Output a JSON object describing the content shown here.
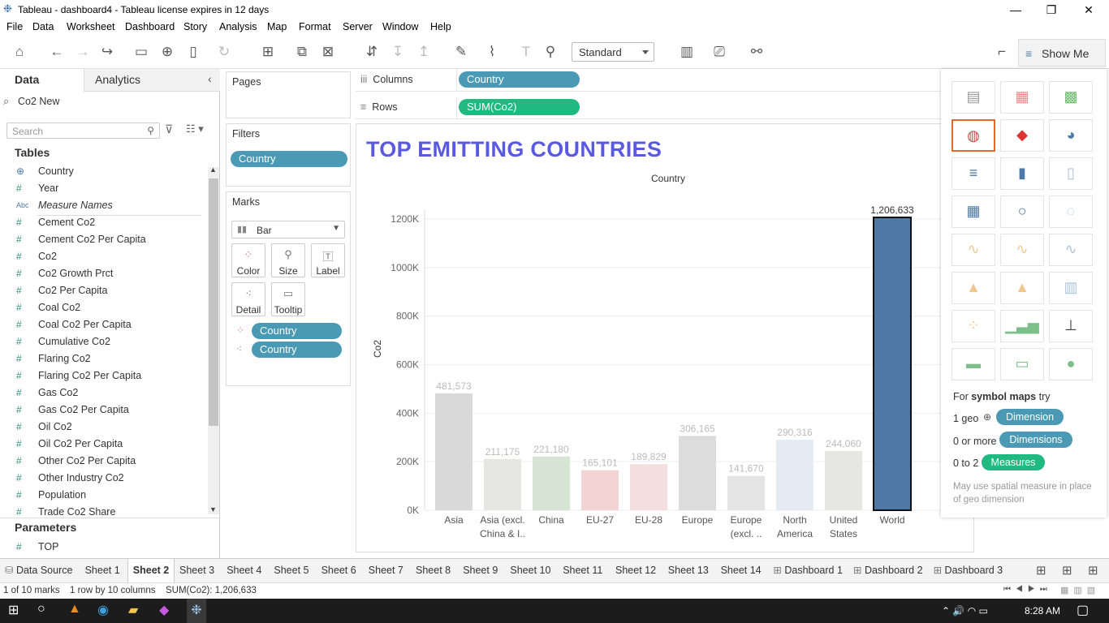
{
  "window": {
    "title": "Tableau - dashboard4 - Tableau license expires in 12 days"
  },
  "menu": [
    "File",
    "Data",
    "Worksheet",
    "Dashboard",
    "Story",
    "Analysis",
    "Map",
    "Format",
    "Server",
    "Window",
    "Help"
  ],
  "toolbar": {
    "fit_select": "Standard",
    "show_me_label": "Show Me"
  },
  "left_panel": {
    "tabs": {
      "data": "Data",
      "analytics": "Analytics"
    },
    "datasource": "Co2 New",
    "search_placeholder": "Search",
    "tables_title": "Tables",
    "fields": [
      {
        "icon": "globe",
        "type": "geo",
        "name": "Country"
      },
      {
        "icon": "#",
        "type": "num",
        "name": "Year"
      },
      {
        "icon": "Abc",
        "type": "text",
        "name": "Measure Names"
      },
      {
        "icon": "#",
        "type": "num",
        "name": "Cement Co2"
      },
      {
        "icon": "#",
        "type": "num",
        "name": "Cement Co2 Per Capita"
      },
      {
        "icon": "#",
        "type": "num",
        "name": "Co2"
      },
      {
        "icon": "#",
        "type": "num",
        "name": "Co2 Growth Prct"
      },
      {
        "icon": "#",
        "type": "num",
        "name": "Co2 Per Capita"
      },
      {
        "icon": "#",
        "type": "num",
        "name": "Coal Co2"
      },
      {
        "icon": "#",
        "type": "num",
        "name": "Coal Co2 Per Capita"
      },
      {
        "icon": "#",
        "type": "num",
        "name": "Cumulative Co2"
      },
      {
        "icon": "#",
        "type": "num",
        "name": "Flaring Co2"
      },
      {
        "icon": "#",
        "type": "num",
        "name": "Flaring Co2 Per Capita"
      },
      {
        "icon": "#",
        "type": "num",
        "name": "Gas Co2"
      },
      {
        "icon": "#",
        "type": "num",
        "name": "Gas Co2 Per Capita"
      },
      {
        "icon": "#",
        "type": "num",
        "name": "Oil Co2"
      },
      {
        "icon": "#",
        "type": "num",
        "name": "Oil Co2 Per Capita"
      },
      {
        "icon": "#",
        "type": "num",
        "name": "Other Co2 Per Capita"
      },
      {
        "icon": "#",
        "type": "num",
        "name": "Other Industry Co2"
      },
      {
        "icon": "#",
        "type": "num",
        "name": "Population"
      },
      {
        "icon": "#",
        "type": "num",
        "name": "Trade Co2 Share"
      }
    ],
    "parameters_title": "Parameters",
    "parameters": [
      "TOP"
    ]
  },
  "shelves": {
    "pages": "Pages",
    "filters": "Filters",
    "filter_pills": [
      "Country"
    ],
    "marks": "Marks",
    "mark_type": "Bar",
    "mark_buttons": [
      "Color",
      "Size",
      "Label",
      "Detail",
      "Tooltip"
    ],
    "mark_pills": [
      "Country",
      "Country"
    ],
    "columns_label": "Columns",
    "columns_pill": "Country",
    "rows_label": "Rows",
    "rows_pill": "SUM(Co2)"
  },
  "sheet": {
    "title": "TOP EMITTING COUNTRIES"
  },
  "chart_data": {
    "type": "bar",
    "title": "",
    "header": "Country",
    "ylabel": "Co2",
    "ylim": [
      0,
      1250000
    ],
    "yticks": [
      0,
      200000,
      400000,
      600000,
      800000,
      1000000,
      1200000
    ],
    "ytick_labels": [
      "0K",
      "200K",
      "400K",
      "600K",
      "800K",
      "1000K",
      "1200K"
    ],
    "categories": [
      "Asia",
      "Asia (excl. China & I..",
      "China",
      "EU-27",
      "EU-28",
      "Europe",
      "Europe (excl. ..",
      "North America",
      "United States",
      "World"
    ],
    "category_lines": [
      [
        "Asia"
      ],
      [
        "Asia (excl.",
        "China & I.."
      ],
      [
        "China"
      ],
      [
        "EU-27"
      ],
      [
        "EU-28"
      ],
      [
        "Europe"
      ],
      [
        "Europe",
        "(excl. .."
      ],
      [
        "North",
        "America"
      ],
      [
        "United",
        "States"
      ],
      [
        "World"
      ]
    ],
    "values": [
      481573,
      211175,
      221180,
      165101,
      189829,
      306165,
      141670,
      290316,
      244060,
      1206633
    ],
    "labels": [
      "481,573",
      "211,175",
      "221,180",
      "165,101",
      "189,829",
      "306,165",
      "141,670",
      "290,316",
      "244,060",
      "1,206,633"
    ],
    "colors": [
      "#d9d9da",
      "#e6e6e3",
      "#d6e4d4",
      "#f3d4d4",
      "#f3dfe0",
      "#dcdcdc",
      "#e4e4e4",
      "#e4ebf2",
      "#e6e6e4",
      "#4e79a7"
    ],
    "selected_index": 9,
    "grid": true
  },
  "show_me": {
    "hint_prefix": "For ",
    "hint_bold": "symbol maps",
    "hint_suffix": " try",
    "rows": [
      {
        "label": "1 geo",
        "pill": "Dimension"
      },
      {
        "label": "0 or more",
        "pill": "Dimensions"
      },
      {
        "label": "0 to 2",
        "pill": "Measures"
      }
    ],
    "note": "May use spatial measure in place of geo dimension"
  },
  "tabs": [
    "Data Source",
    "Sheet 1",
    "Sheet 2",
    "Sheet 3",
    "Sheet 4",
    "Sheet 5",
    "Sheet 6",
    "Sheet 7",
    "Sheet 8",
    "Sheet 9",
    "Sheet 10",
    "Sheet 11",
    "Sheet 12",
    "Sheet 13",
    "Sheet 14",
    "Dashboard 1",
    "Dashboard 2",
    "Dashboard 3"
  ],
  "active_tab": "Sheet 2",
  "status": {
    "marks": "1 of 10 marks",
    "dims": "1 row by 10 columns",
    "sum": "SUM(Co2): 1,206,633"
  },
  "taskbar": {
    "time": "8:28 AM"
  }
}
